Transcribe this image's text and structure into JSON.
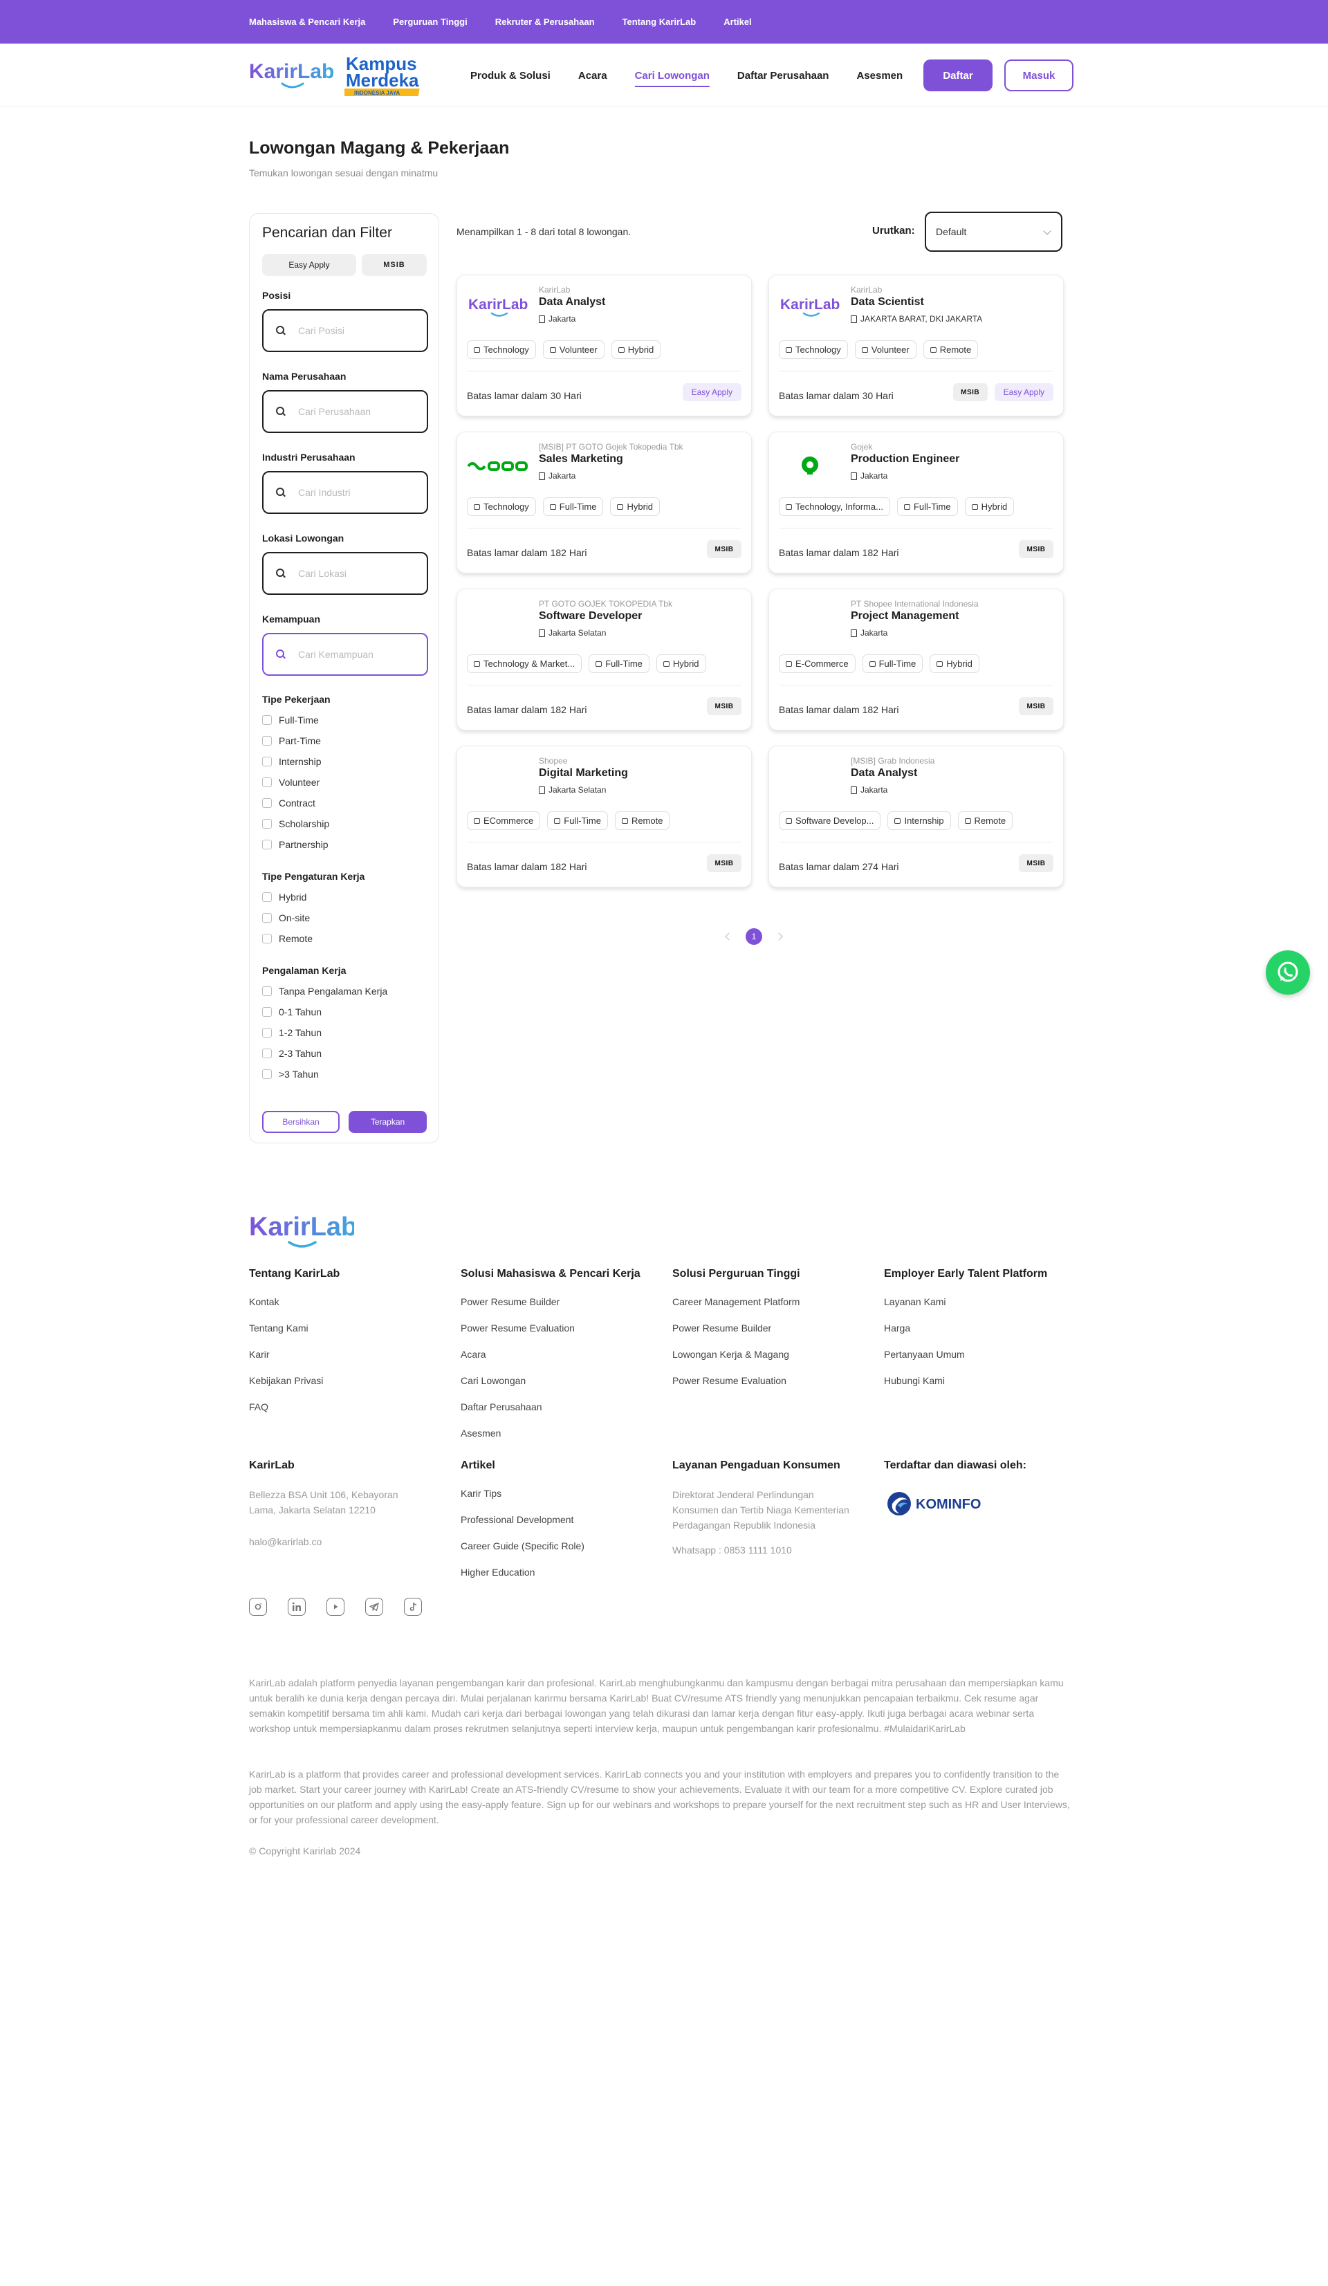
{
  "topbar": {
    "links": [
      "Mahasiswa & Pencari Kerja",
      "Perguruan Tinggi",
      "Rekruter & Perusahaan",
      "Tentang KarirLab",
      "Artikel"
    ]
  },
  "brand": {
    "primary_color": "#7f51d9",
    "logo_text": "KarirLab",
    "partner_logo_line1": "Kampus",
    "partner_logo_line2": "Merdeka",
    "partner_logo_line3": "INDONESIA JAYA"
  },
  "nav": {
    "items": [
      "Produk & Solusi",
      "Acara",
      "Cari Lowongan",
      "Daftar Perusahaan",
      "Asesmen"
    ],
    "active": "Cari Lowongan",
    "register_label": "Daftar",
    "login_label": "Masuk"
  },
  "page": {
    "title": "Lowongan Magang & Pekerjaan",
    "subtitle": "Temukan lowongan sesuai dengan minatmu"
  },
  "filter": {
    "title": "Pencarian dan Filter",
    "chip_easy": "Easy Apply",
    "chip_msib": "MSIB",
    "fields": [
      {
        "label": "Posisi",
        "placeholder": "Cari Posisi"
      },
      {
        "label": "Nama Perusahaan",
        "placeholder": "Cari Perusahaan"
      },
      {
        "label": "Industri Perusahaan",
        "placeholder": "Cari Industri"
      },
      {
        "label": "Lokasi Lowongan",
        "placeholder": "Cari Lokasi"
      },
      {
        "label": "Kemampuan",
        "placeholder": "Cari Kemampuan"
      }
    ],
    "job_type": {
      "label": "Tipe Pekerjaan",
      "options": [
        "Full-Time",
        "Part-Time",
        "Internship",
        "Volunteer",
        "Contract",
        "Scholarship",
        "Partnership"
      ]
    },
    "work_arrangement": {
      "label": "Tipe Pengaturan Kerja",
      "options": [
        "Hybrid",
        "On-site",
        "Remote"
      ]
    },
    "experience": {
      "label": "Pengalaman Kerja",
      "options": [
        "Tanpa Pengalaman Kerja",
        "0-1 Tahun",
        "1-2 Tahun",
        "2-3 Tahun",
        ">3 Tahun"
      ]
    },
    "clear_label": "Bersihkan",
    "apply_label": "Terapkan"
  },
  "results": {
    "summary": "Menampilkan 1 - 8 dari total 8 lowongan.",
    "sort_label": "Urutkan:",
    "sort_value": "Default"
  },
  "jobs": [
    {
      "company": "KarirLab",
      "title": "Data Analyst",
      "location": "Jakarta",
      "tags": [
        "Technology",
        "Volunteer",
        "Hybrid"
      ],
      "deadline": "Batas lamar dalam 30 Hari",
      "msib": "",
      "easy_apply": "Easy Apply",
      "logo": "karirlab"
    },
    {
      "company": "KarirLab",
      "title": "Data Scientist",
      "location": "JAKARTA BARAT, DKI JAKARTA",
      "tags": [
        "Technology",
        "Volunteer",
        "Remote"
      ],
      "deadline": "Batas lamar dalam 30 Hari",
      "msib": "MSIB",
      "easy_apply": "Easy Apply",
      "logo": "karirlab"
    },
    {
      "company": "[MSIB] PT GOTO Gojek Tokopedia Tbk",
      "title": "Sales Marketing",
      "location": "Jakarta",
      "tags": [
        "Technology",
        "Full-Time",
        "Hybrid"
      ],
      "deadline": "Batas lamar dalam 182 Hari",
      "msib": "MSIB",
      "easy_apply": "",
      "logo": "goto"
    },
    {
      "company": "Gojek",
      "title": "Production Engineer",
      "location": "Jakarta",
      "tags": [
        "Technology, Informa...",
        "Full-Time",
        "Hybrid"
      ],
      "deadline": "Batas lamar dalam 182 Hari",
      "msib": "MSIB",
      "easy_apply": "",
      "logo": "gojek"
    },
    {
      "company": "PT GOTO GOJEK TOKOPEDIA Tbk",
      "title": "Software Developer",
      "location": "Jakarta Selatan",
      "tags": [
        "Technology & Market...",
        "Full-Time",
        "Hybrid"
      ],
      "deadline": "Batas lamar dalam 182 Hari",
      "msib": "MSIB",
      "easy_apply": "",
      "logo": "none"
    },
    {
      "company": "PT Shopee International Indonesia",
      "title": "Project Management",
      "location": "Jakarta",
      "tags": [
        "E-Commerce",
        "Full-Time",
        "Hybrid"
      ],
      "deadline": "Batas lamar dalam 182 Hari",
      "msib": "MSIB",
      "easy_apply": "",
      "logo": "none"
    },
    {
      "company": "Shopee",
      "title": "Digital Marketing",
      "location": "Jakarta Selatan",
      "tags": [
        "ECommerce",
        "Full-Time",
        "Remote"
      ],
      "deadline": "Batas lamar dalam 182 Hari",
      "msib": "MSIB",
      "easy_apply": "",
      "logo": "none"
    },
    {
      "company": "[MSIB] Grab Indonesia",
      "title": "Data Analyst",
      "location": "Jakarta",
      "tags": [
        "Software Develop...",
        "Internship",
        "Remote"
      ],
      "deadline": "Batas lamar dalam 274 Hari",
      "msib": "MSIB",
      "easy_apply": "",
      "logo": "none"
    }
  ],
  "pagination": {
    "current": "1"
  },
  "footer": {
    "logo_text": "KarirLab",
    "columns": [
      {
        "title": "Tentang KarirLab",
        "links": [
          "Kontak",
          "Tentang Kami",
          "Karir",
          "Kebijakan Privasi",
          "FAQ"
        ]
      },
      {
        "title": "Solusi Mahasiswa & Pencari Kerja",
        "links": [
          "Power Resume Builder",
          "Power Resume Evaluation",
          "Acara",
          "Cari Lowongan",
          "Daftar Perusahaan",
          "Asesmen"
        ]
      },
      {
        "title": "Solusi Perguruan Tinggi",
        "links": [
          "Career Management Platform",
          "Power Resume Builder",
          "Lowongan Kerja & Magang",
          "Power Resume Evaluation"
        ]
      },
      {
        "title": "Employer Early Talent Platform",
        "links": [
          "Layanan Kami",
          "Harga",
          "Pertanyaan Umum",
          "Hubungi Kami"
        ]
      }
    ],
    "karirlab": {
      "title": "KarirLab",
      "address": "Bellezza BSA Unit 106, Kebayoran Lama, Jakarta Selatan 12210",
      "email": "halo@karirlab.co"
    },
    "artikel": {
      "title": "Artikel",
      "links": [
        "Karir Tips",
        "Professional Development",
        "Career Guide (Specific Role)",
        "Higher Education"
      ]
    },
    "complaints": {
      "title": "Layanan Pengaduan Konsumen",
      "body": "Direktorat Jenderal Perlindungan Konsumen dan Tertib Niaga Kementerian Perdagangan Republik Indonesia",
      "whatsapp": "Whatsapp : 0853 1111 1010"
    },
    "registered": {
      "title": "Terdaftar dan diawasi oleh:",
      "logo_text": "KOMINFO"
    },
    "socials": [
      "instagram-icon",
      "linkedin-icon",
      "youtube-icon",
      "telegram-icon",
      "tiktok-icon"
    ],
    "desc_id": "KarirLab adalah platform penyedia layanan pengembangan karir dan profesional. KarirLab menghubungkanmu dan kampusmu dengan berbagai mitra perusahaan dan mempersiapkan kamu untuk beralih ke dunia kerja dengan percaya diri. Mulai perjalanan karirmu bersama KarirLab! Buat CV/resume ATS friendly yang menunjukkan pencapaian terbaikmu. Cek resume agar semakin kompetitif bersama tim ahli kami. Mudah cari kerja dari berbagai lowongan yang telah dikurasi dan lamar kerja dengan fitur easy-apply. Ikuti juga berbagai acara webinar serta workshop untuk mempersiapkanmu dalam proses rekrutmen selanjutnya seperti interview kerja, maupun untuk pengembangan karir profesionalmu. #MulaidariKarirLab",
    "desc_en": "KarirLab is a platform that provides career and professional development services. KarirLab connects you and your institution with employers and prepares you to confidently transition to the job market. Start your career journey with KarirLab! Create an ATS-friendly CV/resume to show your achievements. Evaluate it with our team for a more competitive CV. Explore curated job opportunities on our platform and apply using the easy-apply feature. Sign up for our webinars and workshops to prepare yourself for the next recruitment step such as HR and User Interviews, or for your professional career development.",
    "copyright": "© Copyright Karirlab 2024"
  }
}
